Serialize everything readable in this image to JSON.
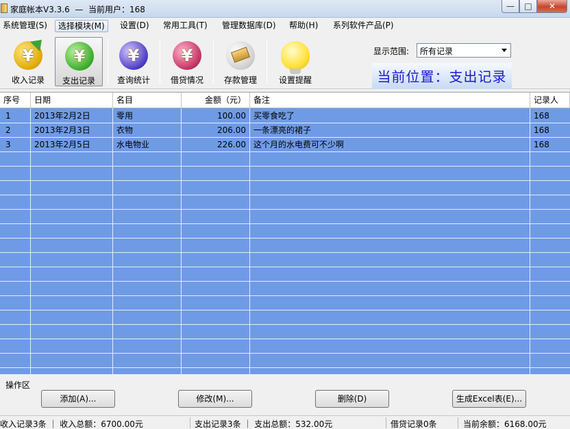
{
  "window": {
    "title": "家庭帐本V3.3.6  —  当前用户：168",
    "minimize": "—",
    "maximize": "□",
    "close": "✕"
  },
  "menu": [
    {
      "label": "系统管理(S)"
    },
    {
      "label": "选择模块(M)"
    },
    {
      "label": "设置(D)"
    },
    {
      "label": "常用工具(T)"
    },
    {
      "label": "管理数据库(D)"
    },
    {
      "label": "帮助(H)"
    },
    {
      "label": "系列软件产品(P)"
    }
  ],
  "toolbar": {
    "tools": [
      {
        "label": "收入记录",
        "icon": "income-yen-icon"
      },
      {
        "label": "支出记录",
        "icon": "expense-yen-icon"
      },
      {
        "label": "查询统计",
        "icon": "query-stats-icon"
      },
      {
        "label": "借贷情况",
        "icon": "loan-yen-icon"
      },
      {
        "label": "存款管理",
        "icon": "deposit-card-icon"
      },
      {
        "label": "设置提醒",
        "icon": "lightbulb-icon"
      }
    ],
    "range_label": "显示范围:",
    "range_value": "所有记录",
    "location": "当前位置：支出记录"
  },
  "grid": {
    "headers": [
      "序号",
      "日期",
      "名目",
      "金额（元）",
      "备注",
      "记录人"
    ],
    "rows": [
      {
        "no": "1",
        "date": "2013年2月2日",
        "item": "零用",
        "amount": "100.00",
        "note": "买零食吃了",
        "recorder": "168"
      },
      {
        "no": "2",
        "date": "2013年2月3日",
        "item": "衣物",
        "amount": "206.00",
        "note": "一条漂亮的裙子",
        "recorder": "168"
      },
      {
        "no": "3",
        "date": "2013年2月5日",
        "item": "水电物业",
        "amount": "226.00",
        "note": "这个月的水电费可不少啊",
        "recorder": "168"
      }
    ]
  },
  "operations": {
    "label": "操作区",
    "add": "添加(A)...",
    "edit": "修改(M)...",
    "delete": "删除(D)",
    "excel": "生成Excel表(E)..."
  },
  "status": {
    "income": "收入记录3条 ｜ 收入总额：6700.00元",
    "expense": "支出记录3条 ｜ 支出总额：532.00元",
    "loan": "借贷记录0条",
    "balance": "当前余额：6168.00元"
  },
  "colors": {
    "grid_bg": "#6f9be6",
    "location_text": "#1a1ad0"
  }
}
